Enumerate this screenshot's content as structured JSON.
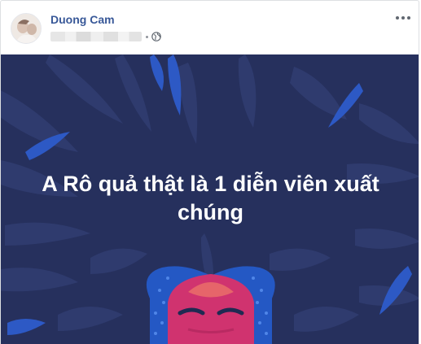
{
  "post": {
    "author_name": "Duong Cam",
    "privacy_icon": "globe-icon",
    "menu_icon": "more-options-icon",
    "caption_line_1": "A Rô quả thật là 1 diễn viên xuất",
    "caption_line_2": "chúng"
  },
  "colors": {
    "author_link": "#385898",
    "background": "#26305d",
    "leaf": "#2f3b6e",
    "leaf_accent": "#2d59c5",
    "mask_face": "#d0336f",
    "mask_frame": "#2458c4"
  }
}
